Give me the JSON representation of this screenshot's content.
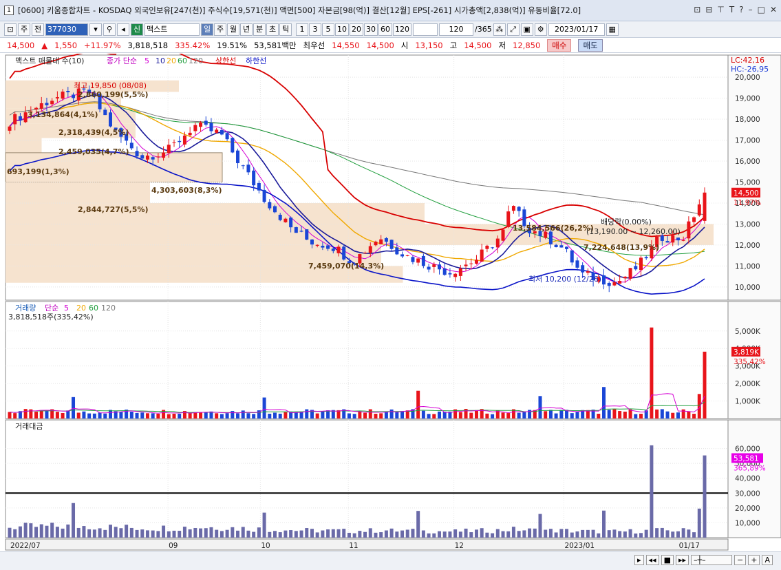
{
  "window": {
    "icon_label": "1",
    "title": "[0600] 키움종합차트 - KOSDAQ 외국인보유[247(천)] 주식수[19,571(천)] 액면[500] 자본금[98(억)] 결산[12월] EPS[-261] 시가총액[2,838(억)] 유동비율[72.0]"
  },
  "toolbar": {
    "period_label": "주",
    "prev_label": "전",
    "code": "377030",
    "credit_label": "신",
    "stock_name": "맥스트",
    "periods": [
      "일",
      "주",
      "월",
      "년",
      "분",
      "초",
      "틱"
    ],
    "active_period": "일",
    "intervals": [
      "1",
      "3",
      "5",
      "10",
      "20",
      "30",
      "60",
      "120"
    ],
    "range": "120",
    "range_total": "/365",
    "date": "2023/01/17"
  },
  "pricebar": {
    "price": "14,500",
    "change": "1,550",
    "change_pct": "+11.97%",
    "volume": "3,818,518",
    "volume_ratio": "335.42%",
    "turnover": "19.51%",
    "amount": "53,581백만",
    "priority_label": "최우선",
    "ask": "14,550",
    "bid": "14,500",
    "open_label": "시",
    "open": "13,150",
    "high_label": "고",
    "high": "14,500",
    "low_label": "저",
    "low": "12,850",
    "buy_label": "매수",
    "sell_label": "매도"
  },
  "price_panel": {
    "legend_title": "맥스트 매물대 수(10)",
    "ma_label": "종가 단순",
    "ma_periods": [
      "5",
      "10",
      "20",
      "60",
      "120"
    ],
    "ma_colors": [
      "#d400d4",
      "#1a1a9a",
      "#f0a800",
      "#1f9e3c",
      "#777777"
    ],
    "upper_label": "상한선",
    "lower_label": "하한선",
    "lc": "LC:42,16",
    "hc": "HC:-26,95",
    "last_price_tag": "14,500",
    "last_pct_tag": "11.97%",
    "high_note": "최고 19,850 (08/08)",
    "low_note": "최저 10,200 (12/26)",
    "dividend_note": "배당락(0.00%)",
    "dividend_range": "(13,190.00 ~ 12,260.00)",
    "y_ticks": [
      "20,000",
      "19,000",
      "18,000",
      "17,000",
      "16,000",
      "15,000",
      "14,000",
      "13,000",
      "12,000",
      "11,000",
      "10,000"
    ],
    "profile_labels": [
      "2,860,199(5,5%)",
      "3,134,864(4,1%)",
      "2,318,439(4,5%)",
      "2,459,035(4,7%)",
      "693,199(1,3%)",
      "4,303,603(8,3%)",
      "2,844,727(5,5%)",
      "7,459,070(14,3%)",
      "13,584,566(26,2%)",
      "7,224,648(13,9%)"
    ]
  },
  "volume_panel": {
    "legend_title": "거래량",
    "ma_label": "단순",
    "ma_periods": [
      "5",
      "20",
      "60",
      "120"
    ],
    "current": "3,818,518주(335,42%)",
    "tag_value": "3,819K",
    "tag_pct": "335,42%",
    "y_ticks": [
      "5,000K",
      "4,000K",
      "3,000K",
      "2,000K",
      "1,000K"
    ]
  },
  "amount_panel": {
    "legend_title": "거래대금",
    "tag_value": "53,581",
    "tag_pct": "365,89%",
    "y_ticks": [
      "60,000",
      "50,000",
      "40,000",
      "30,000",
      "20,000",
      "10,000"
    ]
  },
  "x_axis": {
    "labels": [
      "2022/07",
      "09",
      "10",
      "11",
      "12",
      "2023/01",
      "01/17"
    ]
  },
  "chart_data": {
    "type": "candlestick",
    "x": [
      "2022/07",
      "09",
      "10",
      "11",
      "12",
      "2023/01",
      "01/17"
    ],
    "y_range": [
      9700,
      20400
    ],
    "last_close": 14500,
    "max": {
      "value": 19850,
      "date": "08/08"
    },
    "min": {
      "value": 10200,
      "date": "12/26"
    },
    "volume_last": 3818518,
    "amount_last": 53581
  }
}
